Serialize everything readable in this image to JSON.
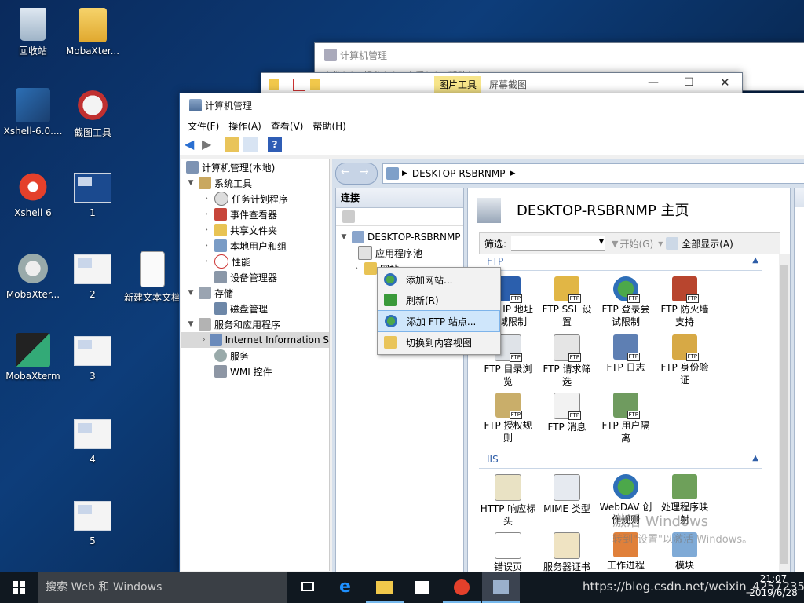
{
  "desktop": {
    "icons": [
      {
        "label": "回收站"
      },
      {
        "label": "MobaXter..."
      },
      {
        "label": "Xshell-6.0...."
      },
      {
        "label": "截图工具"
      },
      {
        "label": "Xshell 6"
      },
      {
        "label": "1"
      },
      {
        "label": "MobaXter..."
      },
      {
        "label": "2"
      },
      {
        "label": "新建文本文档"
      },
      {
        "label": "MobaXterm"
      },
      {
        "label": "3"
      },
      {
        "label": "4"
      },
      {
        "label": "5"
      }
    ]
  },
  "bg_window_1": {
    "title": "计算机管理",
    "menu": [
      "文件(F)",
      "操作(A)",
      "查看(V)",
      "帮助(H)"
    ]
  },
  "bg_window_2": {
    "ribbon_tab_active": "图片工具",
    "ribbon_tab": "屏幕截图"
  },
  "main_window": {
    "title": "计算机管理",
    "menu": [
      "文件(F)",
      "操作(A)",
      "查看(V)",
      "帮助(H)"
    ],
    "tree": {
      "root": "计算机管理(本地)",
      "system_tools": "系统工具",
      "task_scheduler": "任务计划程序",
      "event_viewer": "事件查看器",
      "shared_folders": "共享文件夹",
      "local_users": "本地用户和组",
      "performance": "性能",
      "device_manager": "设备管理器",
      "storage": "存储",
      "disk_mgmt": "磁盘管理",
      "services_apps": "服务和应用程序",
      "iis": "Internet Information S",
      "services": "服务",
      "wmi": "WMI 控件"
    }
  },
  "iis": {
    "address": "DESKTOP-RSBRNMP",
    "connections_header": "连接",
    "conn_tree": {
      "server": "DESKTOP-RSBRNMP",
      "app_pools": "应用程序池",
      "sites": "网站"
    },
    "home_title": "DESKTOP-RSBRNMP 主页",
    "filter_label": "筛选:",
    "filter_start": "开始(G)",
    "filter_showall": "全部显示(A)",
    "group_ftp": "FTP",
    "group_iis": "IIS",
    "ftp_features": [
      {
        "l1": "FTP IP 地址",
        "l2": "和域限制"
      },
      {
        "l1": "FTP SSL 设",
        "l2": "置"
      },
      {
        "l1": "FTP 登录尝",
        "l2": "试限制"
      },
      {
        "l1": "FTP 防火墙",
        "l2": "支持"
      },
      {
        "l1": "FTP 目录浏",
        "l2": "览"
      },
      {
        "l1": "FTP 请求筛",
        "l2": "选"
      },
      {
        "l1": "FTP 日志",
        "l2": ""
      },
      {
        "l1": "FTP 身份验",
        "l2": "证"
      },
      {
        "l1": "FTP 授权规",
        "l2": "则"
      },
      {
        "l1": "FTP 消息",
        "l2": ""
      },
      {
        "l1": "FTP 用户隔",
        "l2": "离"
      }
    ],
    "iis_features": [
      {
        "l1": "HTTP 响应标",
        "l2": "头"
      },
      {
        "l1": "MIME 类型",
        "l2": ""
      },
      {
        "l1": "WebDAV 创",
        "l2": "作规则"
      },
      {
        "l1": "处理程序映",
        "l2": "射"
      },
      {
        "l1": "错误页",
        "l2": ""
      },
      {
        "l1": "服务器证书",
        "l2": ""
      },
      {
        "l1": "工作进程",
        "l2": ""
      },
      {
        "l1": "模块",
        "l2": ""
      }
    ]
  },
  "context_menu": {
    "items": [
      {
        "label": "添加网站..."
      },
      {
        "label": "刷新(R)"
      },
      {
        "label": "添加 FTP 站点..."
      },
      {
        "label": "切换到内容视图"
      }
    ],
    "highlighted_index": 2
  },
  "watermark": {
    "line1": "激活 Windows",
    "line2": "转到\"设置\"以激活 Windows。"
  },
  "taskbar": {
    "search_placeholder": "搜索 Web 和 Windows",
    "time": "21:07",
    "date": "2019/6/28",
    "url_overlay": "https://blog.csdn.net/weixin_42572352"
  }
}
